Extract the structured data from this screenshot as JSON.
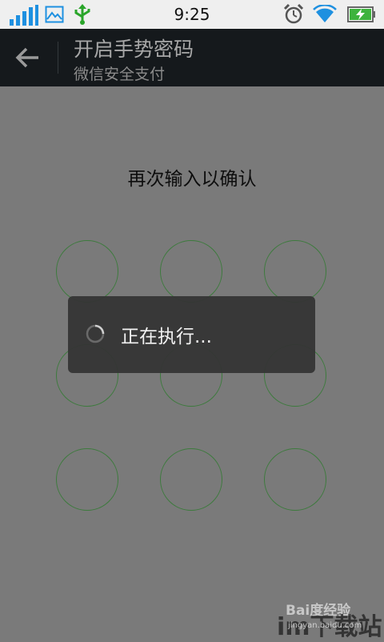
{
  "status_bar": {
    "time": "9:25",
    "icons": [
      "signal-icon",
      "image-icon",
      "usb-icon",
      "alarm-icon",
      "wifi-icon",
      "battery-charging-icon"
    ]
  },
  "action_bar": {
    "title": "开启手势密码",
    "subtitle": "微信安全支付"
  },
  "pattern": {
    "prompt": "再次输入以确认",
    "dots": 9
  },
  "loading": {
    "text": "正在执行..."
  },
  "watermark": {
    "logo": "Bai度经验",
    "site": "im下载站",
    "url": "jingyan.baidu.com"
  },
  "colors": {
    "dot_border": "#3d7a3d",
    "status_accent": "#1e90e0",
    "usb_green": "#2aa52a"
  }
}
